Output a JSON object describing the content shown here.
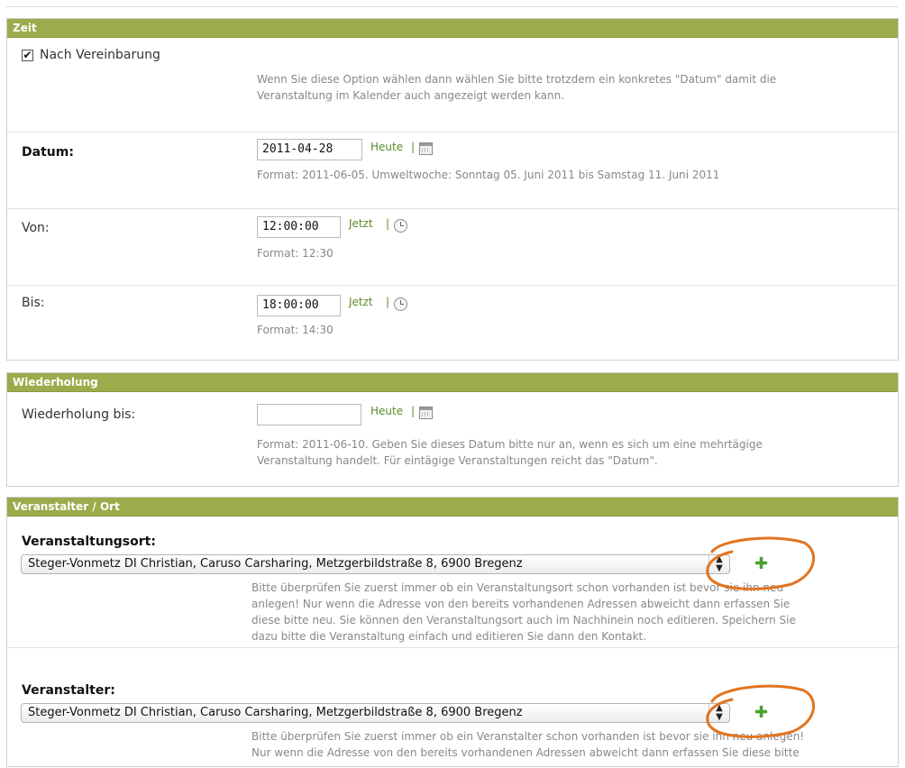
{
  "zeit": {
    "header": "Zeit",
    "nach_vereinbarung": {
      "label": "Nach Vereinbarung",
      "checked": true,
      "help": [
        "Wenn Sie diese Option wählen dann wählen Sie bitte trotzdem ein konkretes \"Datum\" damit die",
        "Veranstaltung im Kalender auch angezeigt werden kann."
      ]
    },
    "datum": {
      "label": "Datum:",
      "value": "2011-04-28",
      "shortcut": "Heute",
      "separator": "|",
      "help": "Format: 2011-06-05. Umweltwoche: Sonntag 05. Juni 2011 bis Samstag 11. Juni 2011"
    },
    "von": {
      "label": "Von:",
      "value": "12:00:00",
      "shortcut": "Jetzt",
      "separator": "|",
      "help": "Format: 12:30"
    },
    "bis": {
      "label": "Bis:",
      "value": "18:00:00",
      "shortcut": "Jetzt",
      "separator": "|",
      "help": "Format: 14:30"
    }
  },
  "wiederholung": {
    "header": "Wiederholung",
    "label": "Wiederholung bis:",
    "value": "",
    "shortcut": "Heute",
    "separator": "|",
    "help": [
      "Format: 2011-06-10. Geben Sie dieses Datum bitte nur an, wenn es sich um eine mehrtägige",
      "Veranstaltung handelt. Für eintägige Veranstaltungen reicht das \"Datum\"."
    ]
  },
  "veranstalter_ort": {
    "header": "Veranstalter / Ort",
    "veranstaltungsort": {
      "label": "Veranstaltungsort:",
      "selected": "Steger-Vonmetz DI Christian, Caruso Carsharing, Metzgerbildstraße 8, 6900 Bregenz",
      "help": [
        "Bitte überprüfen Sie zuerst immer ob ein Veranstaltungsort schon vorhanden ist bevor sie ihn neu",
        "anlegen! Nur wenn die Adresse von den bereits vorhandenen Adressen abweicht dann erfassen Sie",
        "diese bitte neu. Sie können den Veranstaltungsort auch im Nachhinein noch editieren. Speichern Sie",
        "dazu bitte die Veranstaltung einfach und editieren Sie dann den Kontakt."
      ]
    },
    "veranstalter": {
      "label": "Veranstalter:",
      "selected": "Steger-Vonmetz DI Christian, Caruso Carsharing, Metzgerbildstraße 8, 6900 Bregenz",
      "help": [
        "Bitte überprüfen Sie zuerst immer ob ein Veranstalter schon vorhanden ist bevor sie ihn neu anlegen!",
        "Nur wenn die Adresse von den bereits vorhandenen Adressen abweicht dann erfassen Sie diese bitte"
      ]
    }
  },
  "icons": {
    "check": "✔",
    "plus": "✚",
    "select_arrows": "▲▼",
    "calendar": "calendar-icon",
    "clock": "clock-icon"
  },
  "colors": {
    "header_green": "#9aac4b",
    "link_green": "#5b8a2a",
    "plus_green": "#4aa12d",
    "annotation_orange": "#e2741f"
  }
}
